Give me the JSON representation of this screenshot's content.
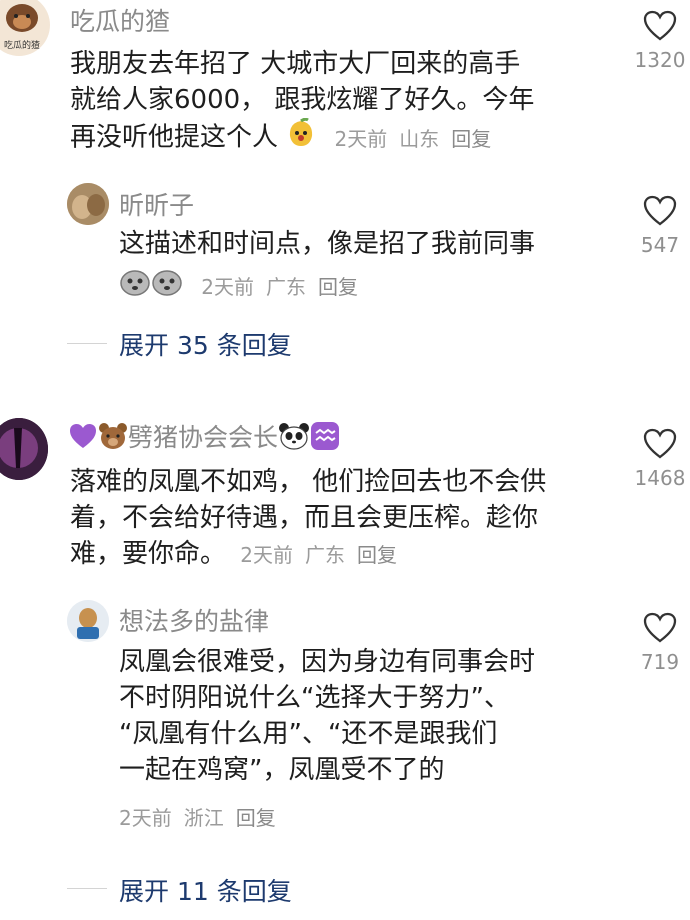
{
  "comments": [
    {
      "username": "吃瓜的猹",
      "avatar_text": "吃瓜的猹",
      "lines": [
        "我朋友去年招了 大城市大厂回来的高手",
        "就给人家6000， 跟我炫耀了好久。今年",
        "再没听他提这个人"
      ],
      "time": "2天前",
      "location": "山东",
      "reply_label": "回复",
      "like_count": "1320",
      "reply": {
        "username": "昕昕子",
        "lines": [
          "这描述和时间点，像是招了我前同事"
        ],
        "time": "2天前",
        "location": "广东",
        "reply_label": "回复",
        "like_count": "547"
      },
      "expand_label": "展开 35 条回复"
    },
    {
      "username": "劈猪协会会长",
      "lines": [
        "落难的凤凰不如鸡， 他们捡回去也不会供",
        "着，不会给好待遇，而且会更压榨。趁你",
        "难，要你命。"
      ],
      "time": "2天前",
      "location": "广东",
      "reply_label": "回复",
      "like_count": "1468",
      "reply": {
        "username": "想法多的盐律",
        "lines": [
          "凤凰会很难受，因为身边有同事会时",
          "不时阴阳说什么“选择大于努力”、",
          "“凤凰有什么用”、“还不是跟我们",
          "一起在鸡窝”，凤凰受不了的"
        ],
        "time": "2天前",
        "location": "浙江",
        "reply_label": "回复",
        "like_count": "719"
      },
      "expand_label": "展开 11 条回复"
    }
  ],
  "colors": {
    "username": "#8a8a8a",
    "text": "#1e1e1e",
    "meta": "#9b9b9b",
    "expand": "#1d3a6e",
    "heart": "#333333"
  },
  "icons": [
    "heart-outline-icon",
    "mango-sticker-icon",
    "crying-face-icon",
    "purple-heart-icon",
    "bear-face-icon",
    "panda-face-icon",
    "aquarius-icon"
  ]
}
